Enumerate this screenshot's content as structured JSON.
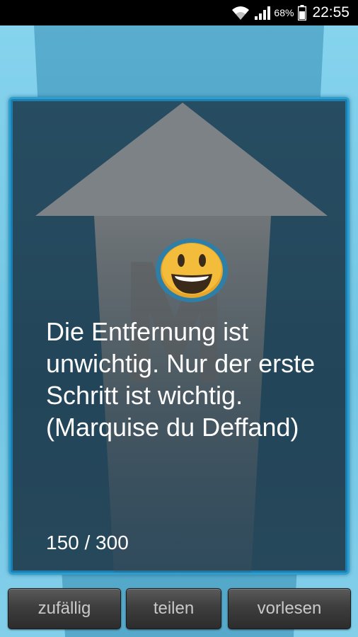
{
  "status_bar": {
    "battery_percent": "68%",
    "time": "22:55",
    "icons": [
      "wifi-icon",
      "signal-icon",
      "battery-icon"
    ]
  },
  "quote": {
    "text": "Die Entfernung ist unwichtig. Nur der erste Schritt ist wichtig. (Marquise du Deffand)",
    "counter": "150 / 300",
    "icon": "smiley-icon"
  },
  "buttons": {
    "random_label": "zufällig",
    "share_label": "teilen",
    "read_label": "vorlesen"
  },
  "colors": {
    "accent": "#2c9fd0",
    "card_background": "#254a5e",
    "background": "#6ec6e4"
  }
}
